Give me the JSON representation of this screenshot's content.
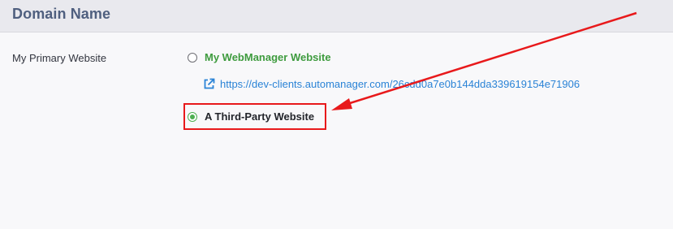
{
  "panel": {
    "title": "Domain Name"
  },
  "field": {
    "label": "My Primary Website"
  },
  "options": [
    {
      "label": "My WebManager Website",
      "selected": false
    },
    {
      "label": "A Third-Party Website",
      "selected": true
    }
  ],
  "link": {
    "icon": "external-link-icon",
    "url": "https://dev-clients.automanager.com/26cdd0a7e0b144dda339619154e71906"
  },
  "annotation": {
    "color": "#e8191b",
    "shapes": [
      "highlight-box",
      "arrow"
    ]
  },
  "colors": {
    "accent_green": "#4caf50",
    "link_blue": "#2a83d6",
    "title_slate": "#4f5f7f"
  }
}
